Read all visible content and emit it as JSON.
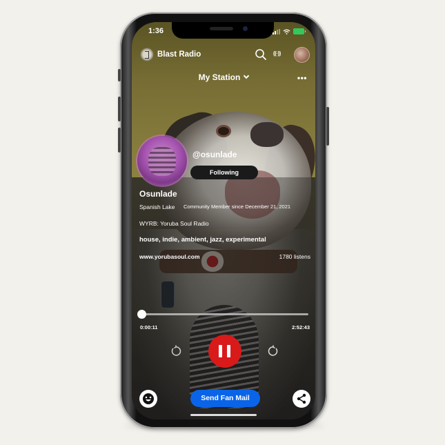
{
  "status_bar": {
    "time": "1:36",
    "battery_color": "#34c759"
  },
  "app_bar": {
    "title": "Blast Radio",
    "icons": [
      "logo-icon",
      "search-icon",
      "broadcast-icon",
      "user-avatar"
    ],
    "broadcast_glyph": "((·))"
  },
  "station_selector": {
    "label": "My Station",
    "more_glyph": "•••"
  },
  "profile": {
    "handle": "@osunlade",
    "follow_button": "Following",
    "name": "Osunlade",
    "location": "Spanish Lake",
    "member_since": "Community Member since December 21, 2021",
    "station": "WYRB: Yoruba Soul Radio",
    "genres": "house, indie, ambient, jazz, experimental",
    "website": "www.yorubasoul.com",
    "listens": "1780 listens"
  },
  "player": {
    "elapsed": "0:00:11",
    "total": "2:52:43",
    "progress_fraction": 0.001,
    "state": "playing",
    "accent_color": "#d91a1a"
  },
  "bottom_bar": {
    "fan_mail_label": "Send Fan Mail",
    "fan_mail_color": "#0a64e8"
  }
}
